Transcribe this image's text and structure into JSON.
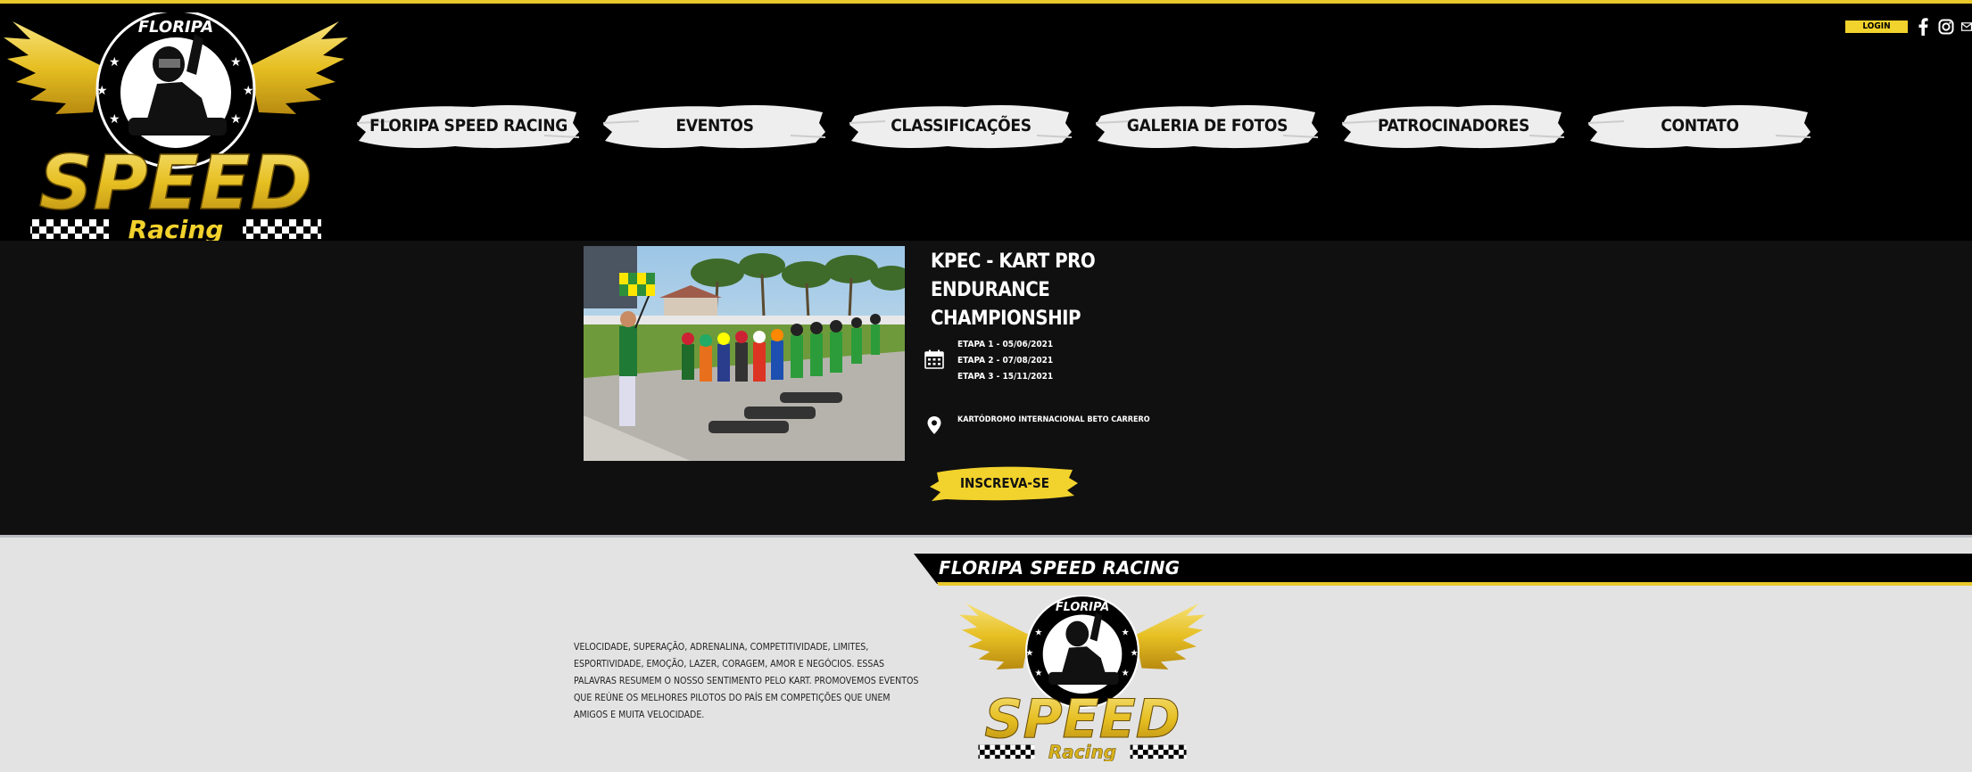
{
  "header": {
    "logo": {
      "top_text": "FLORIPA",
      "main_text": "SPEED",
      "sub_text": "Racing"
    },
    "login_label": "LOGIN",
    "social_icons": [
      "facebook-icon",
      "instagram-icon",
      "mail-icon"
    ]
  },
  "nav": {
    "items": [
      {
        "label": "FLORIPA SPEED RACING"
      },
      {
        "label": "EVENTOS"
      },
      {
        "label": "CLASSIFICAÇÕES"
      },
      {
        "label": "GALERIA DE FOTOS"
      },
      {
        "label": "PATROCINADORES"
      },
      {
        "label": "CONTATO"
      }
    ]
  },
  "event": {
    "title_line1": "KPEC - KART PRO ENDURANCE",
    "title_line2": "CHAMPIONSHIP",
    "stages": [
      "ETAPA 1 - 05/06/2021",
      "ETAPA 2 - 07/08/2021",
      "ETAPA 3 - 15/11/2021"
    ],
    "venue": "KARTÓDROMO INTERNACIONAL BETO CARRERO",
    "cta_label": "INSCREVA-SE"
  },
  "footer": {
    "brand": "FLORIPA SPEED RACING",
    "description": "VELOCIDADE, SUPERAÇÃO, ADRENALINA, COMPETITIVIDADE, LIMITES, ESPORTIVIDADE, EMOÇÃO, LAZER, CORAGEM, AMOR E NEGÓCIOS. ESSAS PALAVRAS RESUMEM O NOSSO SENTIMENTO PELO KART. PROMOVEMOS EVENTOS QUE REÚNE OS MELHORES PILOTOS DO PAÍS EM COMPETIÇÕES QUE UNEM AMIGOS E MUITA VELOCIDADE."
  },
  "colors": {
    "accent_yellow": "#f2d22c",
    "gold": "#e9c82b",
    "header_bg": "#000000",
    "event_bg": "#101010",
    "footer_bg": "#e3e3e3"
  }
}
